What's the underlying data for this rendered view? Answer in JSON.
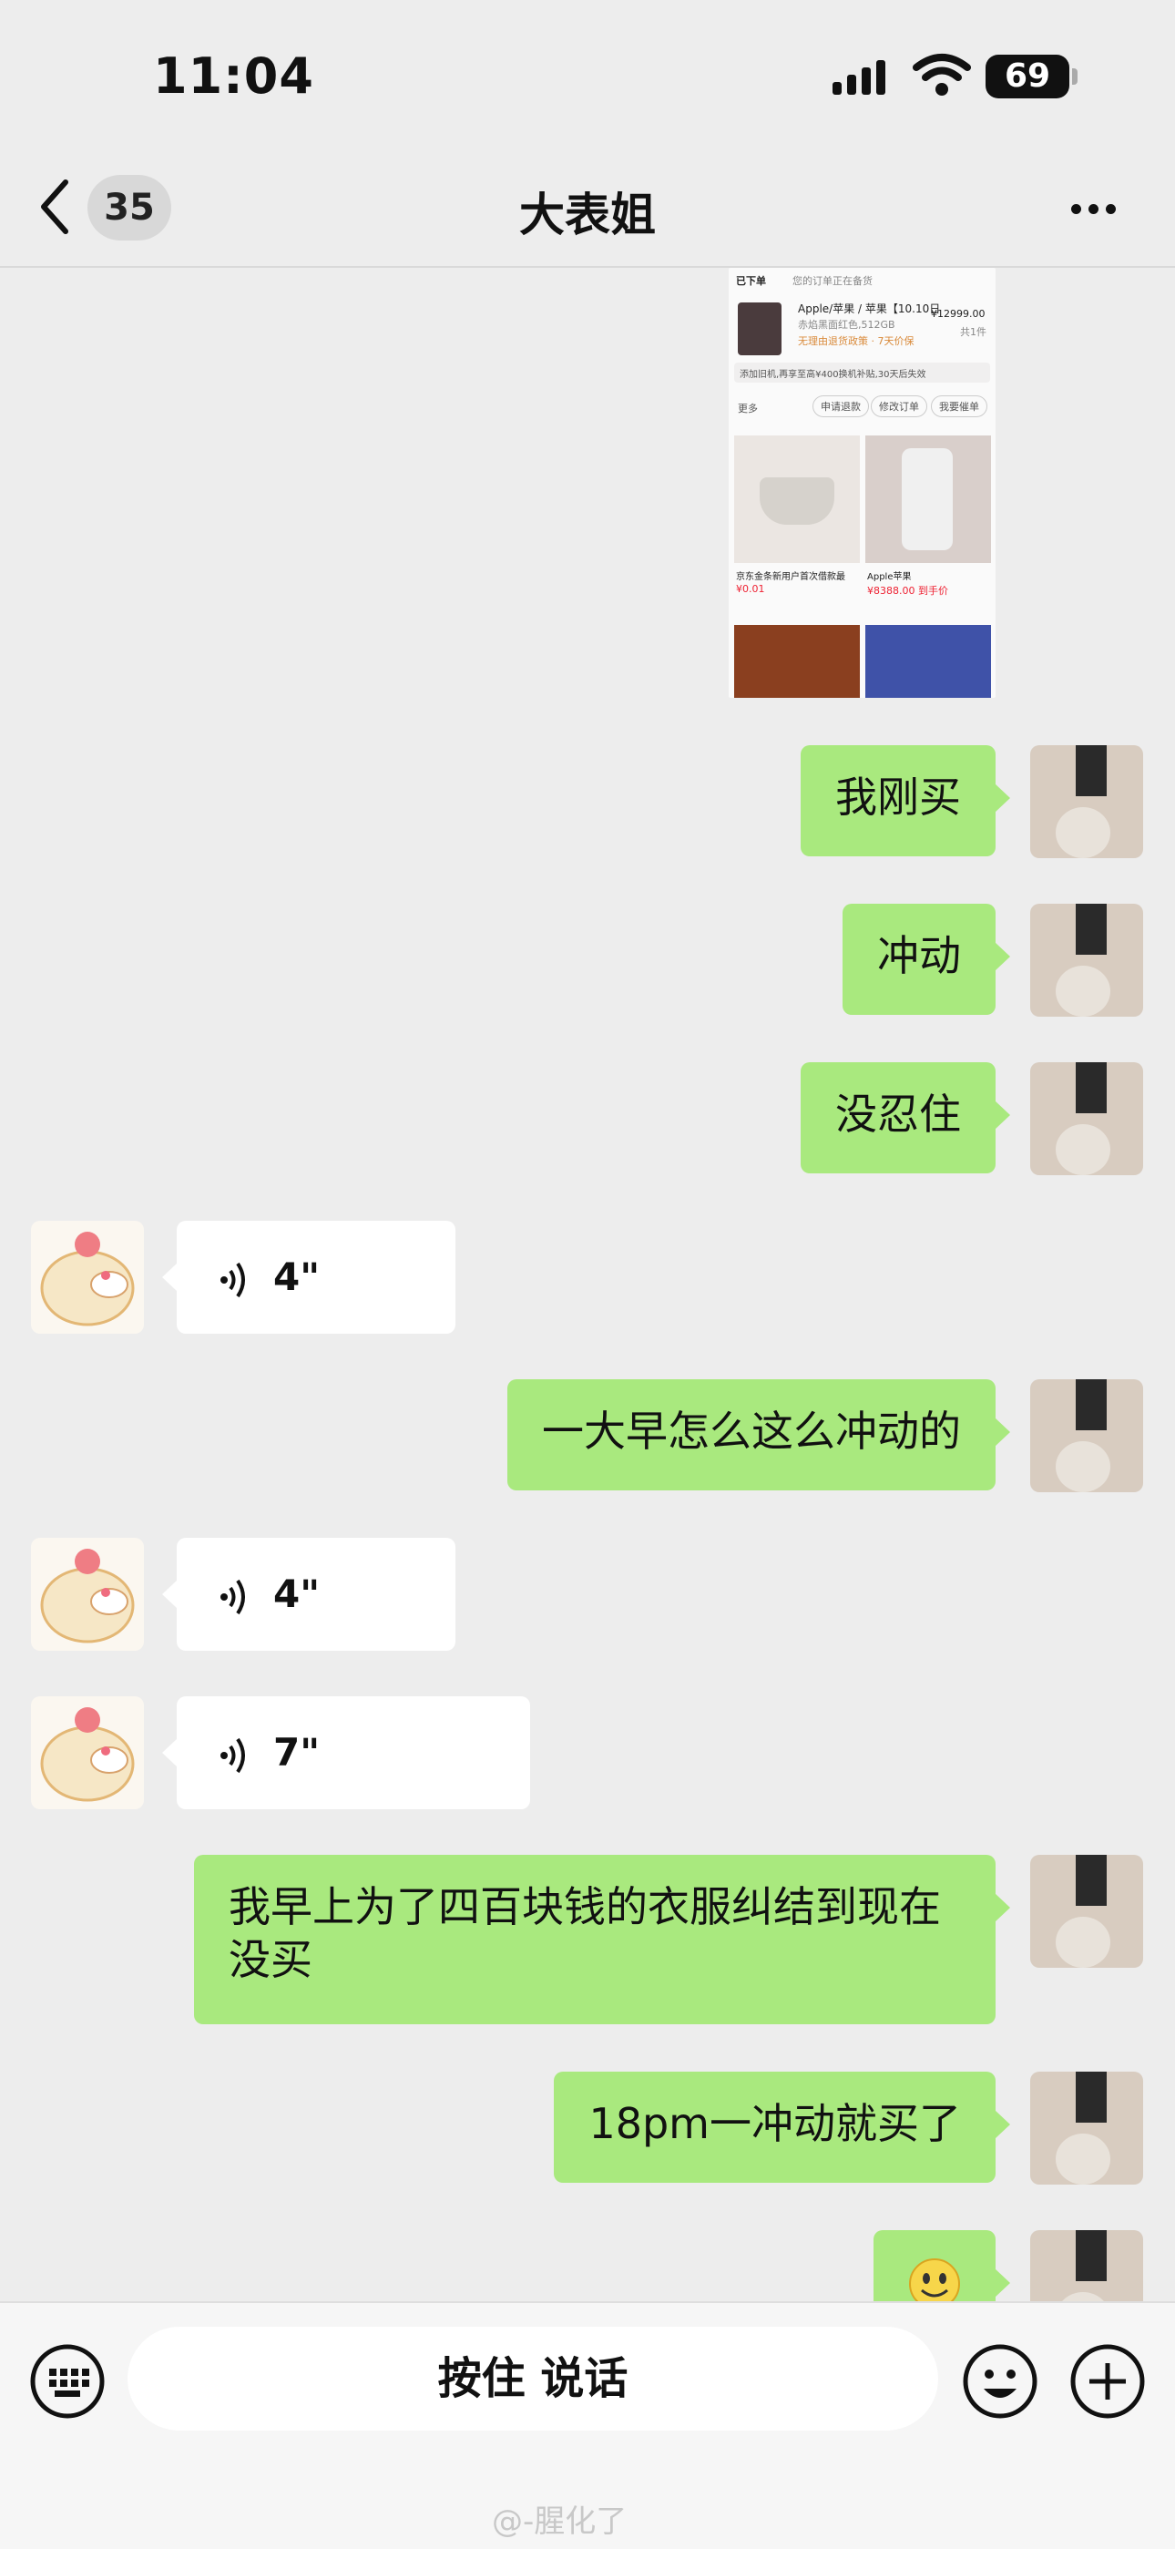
{
  "status_bar": {
    "time": "11:04",
    "battery": "69"
  },
  "header": {
    "unread_count": "35",
    "title": "大表姐"
  },
  "shared_image": {
    "order_status": "已下单",
    "order_note": "您的订单正在备货",
    "product_name": "Apple/苹果 / 苹果【10.10日",
    "product_spec": "赤焰黑面红色,512GB",
    "product_tag": "无理由退货政策 · 7天价保",
    "price": "¥12999.00",
    "qty": "共1件",
    "subsidy_note": "添加旧机,再享至高¥400换机补贴,30天后失效",
    "more": "更多",
    "btn_refund": "申请退款",
    "btn_modify": "修改订单",
    "btn_urge": "我要催单",
    "rec1_title": "京东金条新用户首次借款最",
    "rec1_price": "¥0.01",
    "rec2_title": "Apple苹果",
    "rec2_price": "¥8388.00 到手价"
  },
  "messages": [
    {
      "side": "me",
      "text": "我刚买"
    },
    {
      "side": "me",
      "text": "冲动"
    },
    {
      "side": "me",
      "text": "没忍住"
    },
    {
      "side": "other",
      "type": "voice",
      "duration": "4\""
    },
    {
      "side": "me",
      "text": "一大早怎么这么冲动的"
    },
    {
      "side": "other",
      "type": "voice",
      "duration": "4\""
    },
    {
      "side": "other",
      "type": "voice",
      "duration": "7\""
    },
    {
      "side": "me",
      "text": "我早上为了四百块钱的衣服纠结到现在没买"
    },
    {
      "side": "me",
      "text": "18pm一冲动就买了"
    },
    {
      "side": "me",
      "type": "emoji",
      "emoji": "smiling-face"
    }
  ],
  "input_bar": {
    "hold_to_talk": "按住 说话"
  },
  "watermark": "@-腥化了",
  "colors": {
    "my_bubble": "#a9e97e",
    "their_bubble": "#ffffff",
    "background": "#ededed"
  }
}
